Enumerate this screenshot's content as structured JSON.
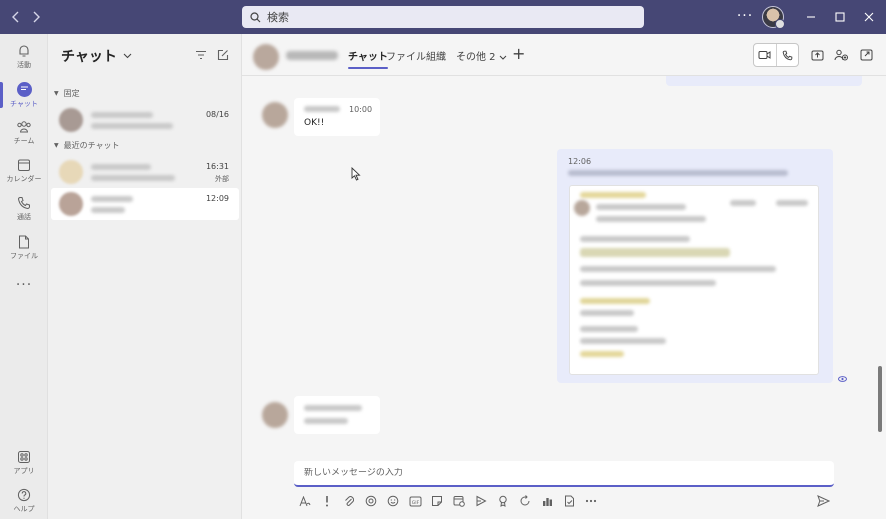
{
  "titlebar": {
    "search_placeholder": "検索",
    "more_label": "···"
  },
  "rail": {
    "items": [
      {
        "label": "活動",
        "icon": "bell-icon"
      },
      {
        "label": "チャット",
        "icon": "chat-icon",
        "active": true
      },
      {
        "label": "チーム",
        "icon": "teams-icon"
      },
      {
        "label": "カレンダー",
        "icon": "calendar-icon"
      },
      {
        "label": "通話",
        "icon": "phone-icon"
      },
      {
        "label": "ファイル",
        "icon": "file-icon"
      }
    ],
    "more": "···",
    "apps_label": "アプリ",
    "help_label": "ヘルプ"
  },
  "chat_list": {
    "title": "チャット",
    "sections": {
      "pinned": "固定",
      "recent": "最近のチャット"
    },
    "rows": [
      {
        "time": "08/16",
        "tag": ""
      },
      {
        "time": "16:31",
        "tag": "外部"
      },
      {
        "time": "12:09",
        "tag": "",
        "selected": true
      }
    ]
  },
  "header": {
    "tabs": [
      {
        "label": "チャット",
        "active": true
      },
      {
        "label": "ファイル"
      },
      {
        "label": "組織"
      },
      {
        "label": "その他 2"
      }
    ],
    "add_tab": "+"
  },
  "messages": {
    "first": {
      "time": "10:00",
      "text": "OK!!"
    },
    "outgoing": {
      "time": "12:06"
    }
  },
  "compose": {
    "placeholder": "新しいメッセージの入力"
  },
  "colors": {
    "titlebar": "#464775",
    "accent": "#5b5fc7",
    "bubble_out": "#e8ebfa"
  }
}
